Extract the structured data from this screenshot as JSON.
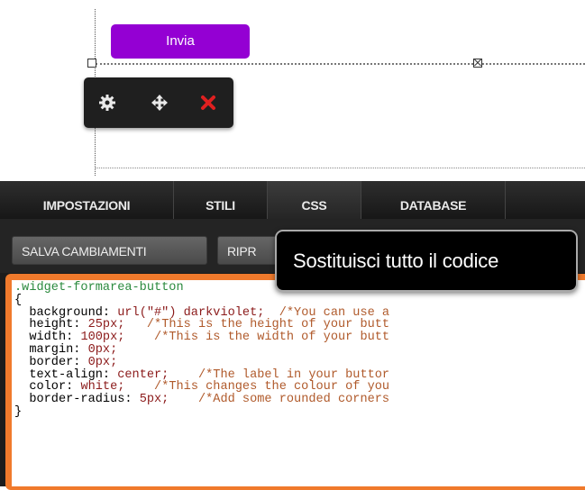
{
  "canvas": {
    "submit_button_label": "Invia"
  },
  "widget_toolbar": {
    "settings_icon": "gear-icon",
    "move_icon": "move-arrows-icon",
    "delete_icon": "close-icon",
    "delete_color": "#e02020"
  },
  "tabs": [
    {
      "label": "IMPOSTAZIONI"
    },
    {
      "label": "STILI"
    },
    {
      "label": "CSS"
    },
    {
      "label": "DATABASE"
    }
  ],
  "toolbar": {
    "save_label": "SALVA CAMBIAMENTI",
    "restore_label": "RIPR"
  },
  "tooltip": {
    "text": "Sostituisci tutto il codice"
  },
  "code": {
    "selector": ".widget-formarea-button",
    "open_brace": "{",
    "close_brace": "}",
    "lines": [
      {
        "prop": "background: ",
        "value": "url(\"#\") darkviolet;",
        "comment": "/*You can use a"
      },
      {
        "prop": "height: ",
        "value": "25px;",
        "comment": "/*This is the height of your butt"
      },
      {
        "prop": "width: ",
        "value": "100px;",
        "comment": "/*This is the width of your butt"
      },
      {
        "prop": "margin: ",
        "value": "0px;",
        "comment": ""
      },
      {
        "prop": "border: ",
        "value": "0px;",
        "comment": ""
      },
      {
        "prop": "text-align: ",
        "value": "center;",
        "comment": "/*The label in your buttor"
      },
      {
        "prop": "color: ",
        "value": "white;",
        "comment": "/*This changes the colour of you"
      },
      {
        "prop": "border-radius: ",
        "value": "5px;",
        "comment": "/*Add some rounded corners"
      }
    ]
  },
  "colors": {
    "accent_button": "#9400d3",
    "editor_border": "#f07a2c"
  }
}
